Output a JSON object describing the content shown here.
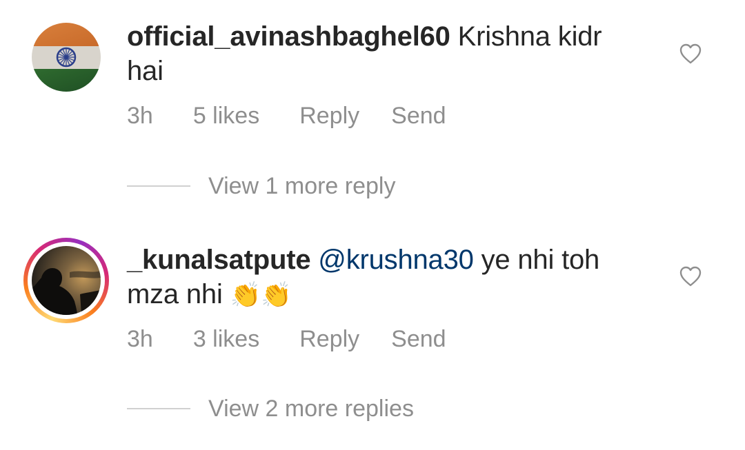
{
  "comments": [
    {
      "username": "official_avinashbaghel60",
      "mention": "",
      "text": " Krishna kidr hai",
      "emoji": "",
      "time": "3h",
      "likes": "5 likes",
      "reply_label": "Reply",
      "send_label": "Send",
      "view_more": "View 1 more reply",
      "has_story_ring": false,
      "avatar_icon": "india-flag-avatar"
    },
    {
      "username": "_kunalsatpute",
      "mention": "@krushna30",
      "text": " ye nhi toh mza nhi ",
      "emoji": "👏👏",
      "time": "3h",
      "likes": "3 likes",
      "reply_label": "Reply",
      "send_label": "Send",
      "view_more": "View 2 more replies",
      "has_story_ring": true,
      "avatar_icon": "silhouette-sunset-avatar"
    }
  ],
  "colors": {
    "text": "#262626",
    "muted": "#8e8e8e",
    "mention": "#00376b",
    "divider": "#d0d0d0"
  }
}
